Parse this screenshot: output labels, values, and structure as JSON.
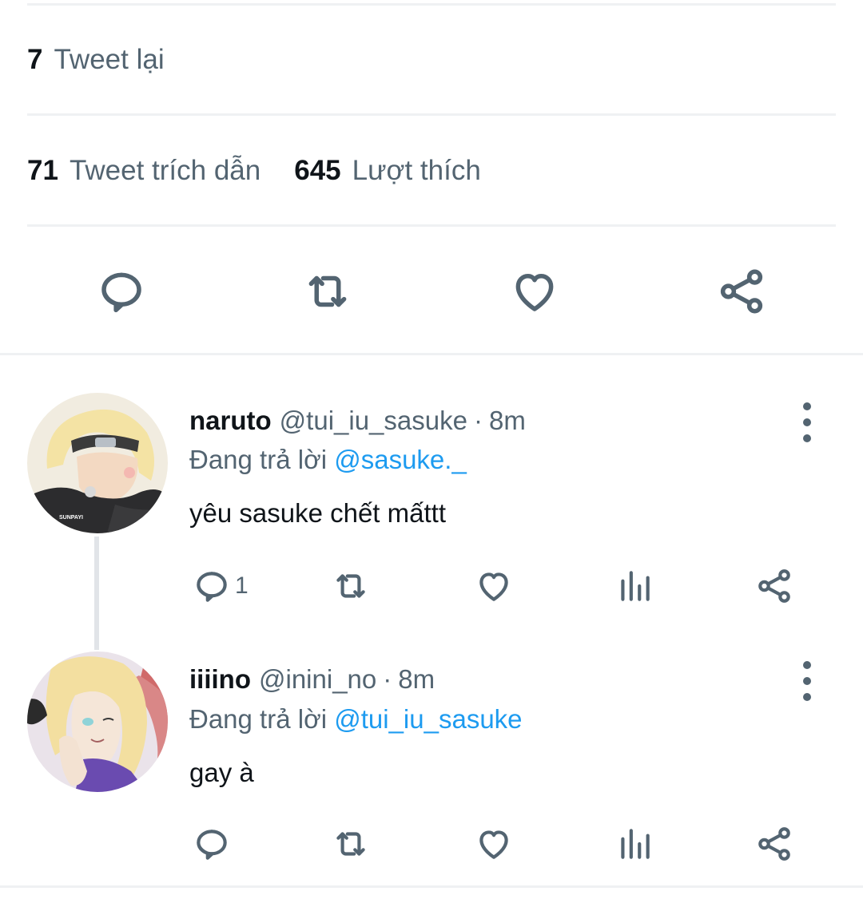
{
  "stats": {
    "retweets": {
      "count": "7",
      "label": "Tweet lại"
    },
    "quotes": {
      "count": "71",
      "label": "Tweet trích dẫn"
    },
    "likes": {
      "count": "645",
      "label": "Lượt thích"
    }
  },
  "action_bar": {
    "icons": [
      "reply-icon",
      "retweet-icon",
      "like-icon",
      "share-icon"
    ]
  },
  "replies": [
    {
      "name": "naruto",
      "handle": "@tui_iu_sasuke",
      "separator": "·",
      "time": "8m",
      "replying_prefix": "Đang trả lời",
      "replying_to": "@sasuke._",
      "text": "yêu sasuke chết mấttt",
      "reply_count": "1",
      "avatar_caption": "SUNPAYI"
    },
    {
      "name": "iiiino",
      "handle": "@inini_no",
      "separator": "·",
      "time": "8m",
      "replying_prefix": "Đang trả lời",
      "replying_to": "@tui_iu_sasuke",
      "text": "gay à",
      "reply_count": ""
    }
  ],
  "colors": {
    "text": "#0f1419",
    "secondary": "#536471",
    "link": "#1d9bf0",
    "divider": "#eff1f3"
  }
}
